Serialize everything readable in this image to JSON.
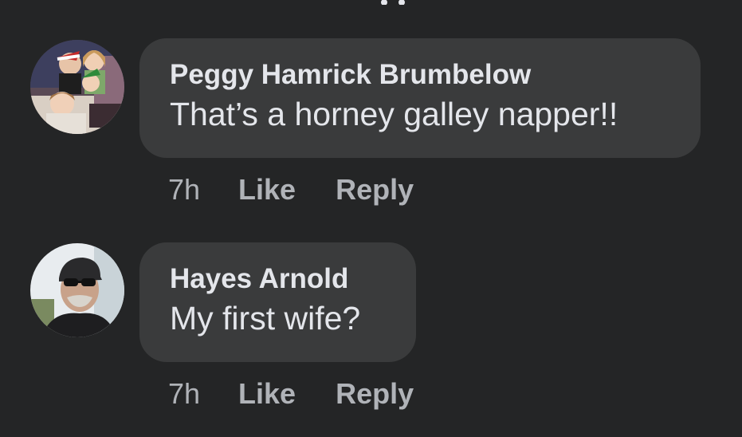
{
  "comments": [
    {
      "author": "Peggy Hamrick Brumbelow",
      "text": "That’s a horney galley napper!!",
      "time": "7h",
      "like_label": "Like",
      "reply_label": "Reply"
    },
    {
      "author": "Hayes Arnold",
      "text": "My first wife?",
      "time": "7h",
      "like_label": "Like",
      "reply_label": "Reply"
    }
  ],
  "colors": {
    "background": "#242526",
    "bubble": "#3a3b3c",
    "primary_text": "#e4e6eb",
    "secondary_text": "#b0b3b8"
  }
}
